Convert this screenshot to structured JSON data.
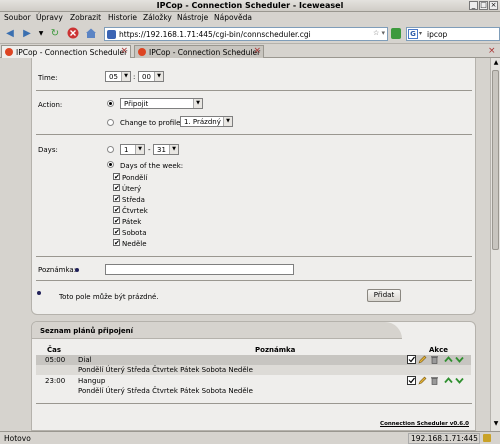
{
  "window": {
    "title": "IPCop - Connection Scheduler - Iceweasel"
  },
  "menu": [
    "Soubor",
    "Úpravy",
    "Zobrazit",
    "Historie",
    "Záložky",
    "Nástroje",
    "Nápověda"
  ],
  "nav": {
    "url": "https://192.168.1.71:445/cgi-bin/connscheduler.cgi",
    "search": "ipcop",
    "search_engine_icon": "G"
  },
  "tabs": [
    {
      "label": "IPCop - Connection Scheduler"
    },
    {
      "label": "IPCop - Connection Scheduler"
    }
  ],
  "form": {
    "time_label": "Time:",
    "hour": "05",
    "minute": "00",
    "action_label": "Action:",
    "action_value": "Připojit",
    "change_profile_label": "Change to profile:",
    "profile_value": "1. Prázdný",
    "days_label": "Days:",
    "day_from": "1",
    "day_to": "31",
    "dash": "-",
    "days_of_week_label": "Days of the week:",
    "weekdays": [
      "Pondělí",
      "Úterý",
      "Středa",
      "Čtvrtek",
      "Pátek",
      "Sobota",
      "Neděle"
    ],
    "check_mark": "✔",
    "note_label": "Poznámka:",
    "note_value": "",
    "optional_hint": "Toto pole může být prázdné.",
    "add_button": "Přidat"
  },
  "list": {
    "title": "Seznam plánů připojení",
    "col_time": "Čas",
    "col_note": "Poznámka",
    "col_actions": "Akce",
    "rows": [
      {
        "time": "05:00",
        "action": "Dial",
        "days": "Pondělí Úterý Středa Čtvrtek Pátek Sobota Neděle"
      },
      {
        "time": "23:00",
        "action": "Hangup",
        "days": "Pondělí Úterý Středa Čtvrtek Pátek Sobota Neděle"
      }
    ],
    "footer": "Connection Scheduler v0.6.0"
  },
  "status": {
    "text": "Hotovo",
    "ip": "192.168.1.71:445"
  },
  "colors": {
    "row_highlight": "#c7c5c1",
    "up_arrow": "#2f8f2f",
    "accent": "#22225a"
  }
}
